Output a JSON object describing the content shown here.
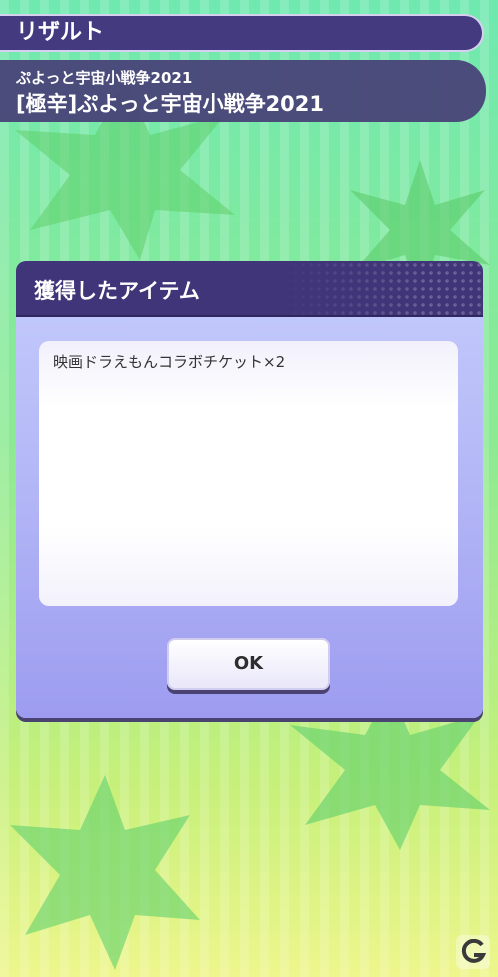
{
  "header": {
    "title": "リザルト",
    "stage_subtitle": "ぷよっと宇宙小戦争2021",
    "stage_title": "[極辛]ぷよっと宇宙小戦争2021"
  },
  "dialog": {
    "title": "獲得したアイテム",
    "items": [
      "映画ドラえもんコラボチケット×2"
    ],
    "ok_label": "OK"
  },
  "colors": {
    "bar_purple": "#433a80",
    "bg_green": "#8cea93",
    "bg_yellow": "#eef68c",
    "dialog_lavender": "#b3b6f6"
  },
  "icons": [
    "star-burst-decoration",
    "site-logo-icon"
  ]
}
